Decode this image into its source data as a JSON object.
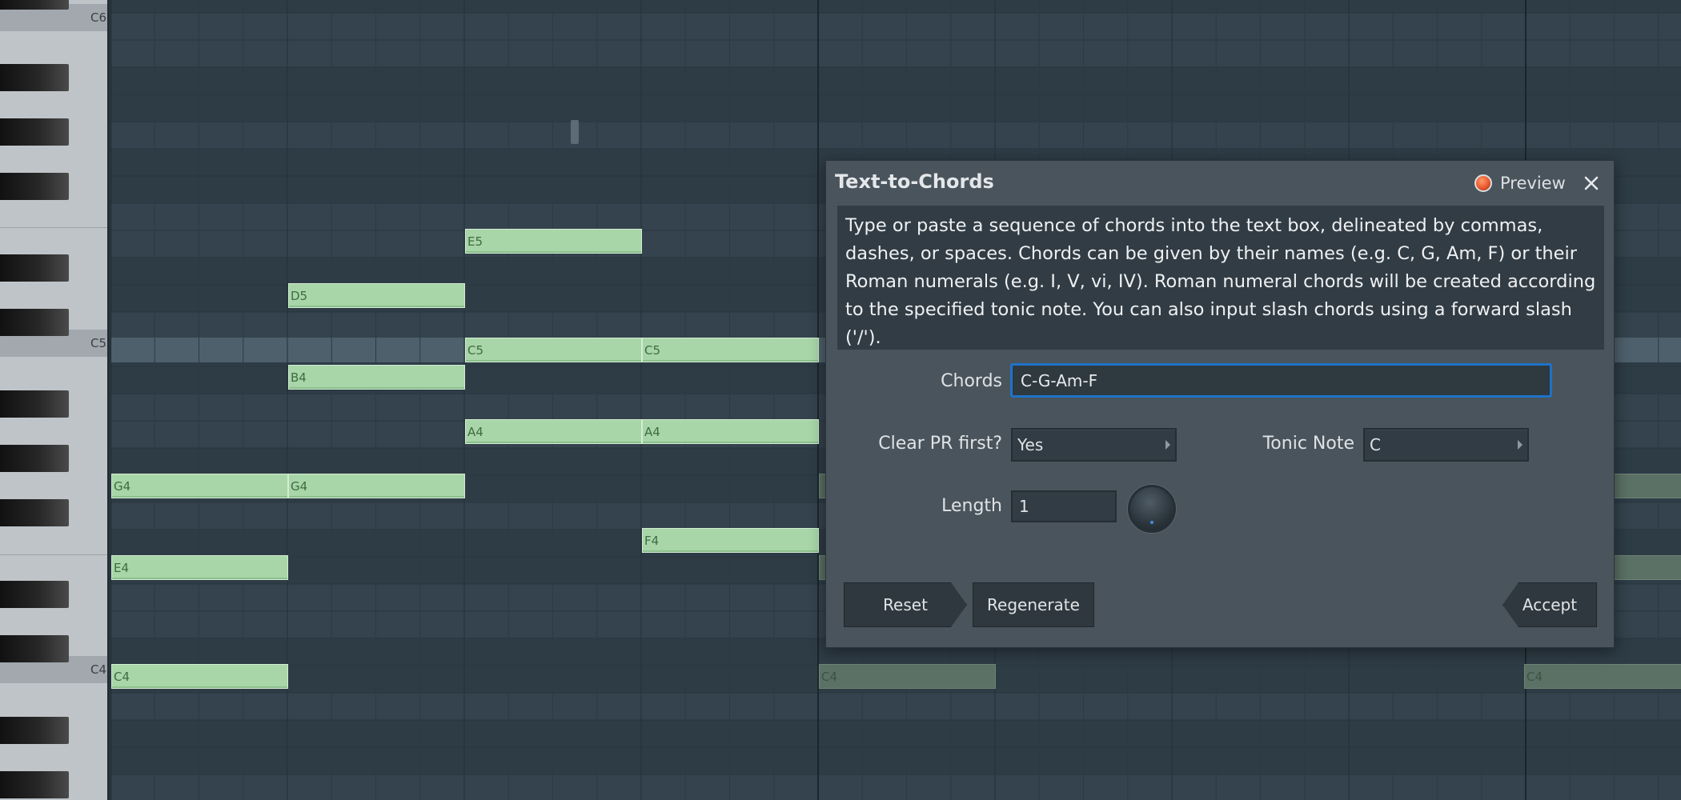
{
  "keyboard": {
    "labels": {
      "c6": "C6",
      "c5": "C5",
      "c4": "C4"
    }
  },
  "notes": {
    "e5": "E5",
    "d5": "D5",
    "c5_a": "C5",
    "c5_b": "C5",
    "b4": "B4",
    "a4_a": "A4",
    "a4_b": "A4",
    "g4_a": "G4",
    "g4_b": "G4",
    "f4": "F4",
    "e4": "E4",
    "c4": "C4",
    "ghost_c4_a": "C4",
    "ghost_c4_b": "C4"
  },
  "dialog": {
    "title": "Text-to-Chords",
    "preview_label": "Preview",
    "description": "Type or paste a sequence of chords into the text box, delineated by commas, dashes, or spaces. Chords can be given by their names (e.g. C, G, Am, F) or their Roman numerals (e.g. I, V, vi, IV). Roman numeral chords will be created according to the specified tonic note. You can also input slash chords using a forward slash ('/').",
    "chords_label": "Chords",
    "chords_value": "C-G-Am-F",
    "clear_label": "Clear PR first?",
    "clear_value": "Yes",
    "tonic_label": "Tonic Note",
    "tonic_value": "C",
    "length_label": "Length",
    "length_value": "1",
    "reset_label": "Reset",
    "regenerate_label": "Regenerate",
    "accept_label": "Accept"
  },
  "colors": {
    "note_fill": "#a8d6a8",
    "ghost_note_fill": "#5b7165",
    "grid_background": "#34434d",
    "focus_border": "#1e73c8",
    "preview_led": "#e8582e"
  }
}
